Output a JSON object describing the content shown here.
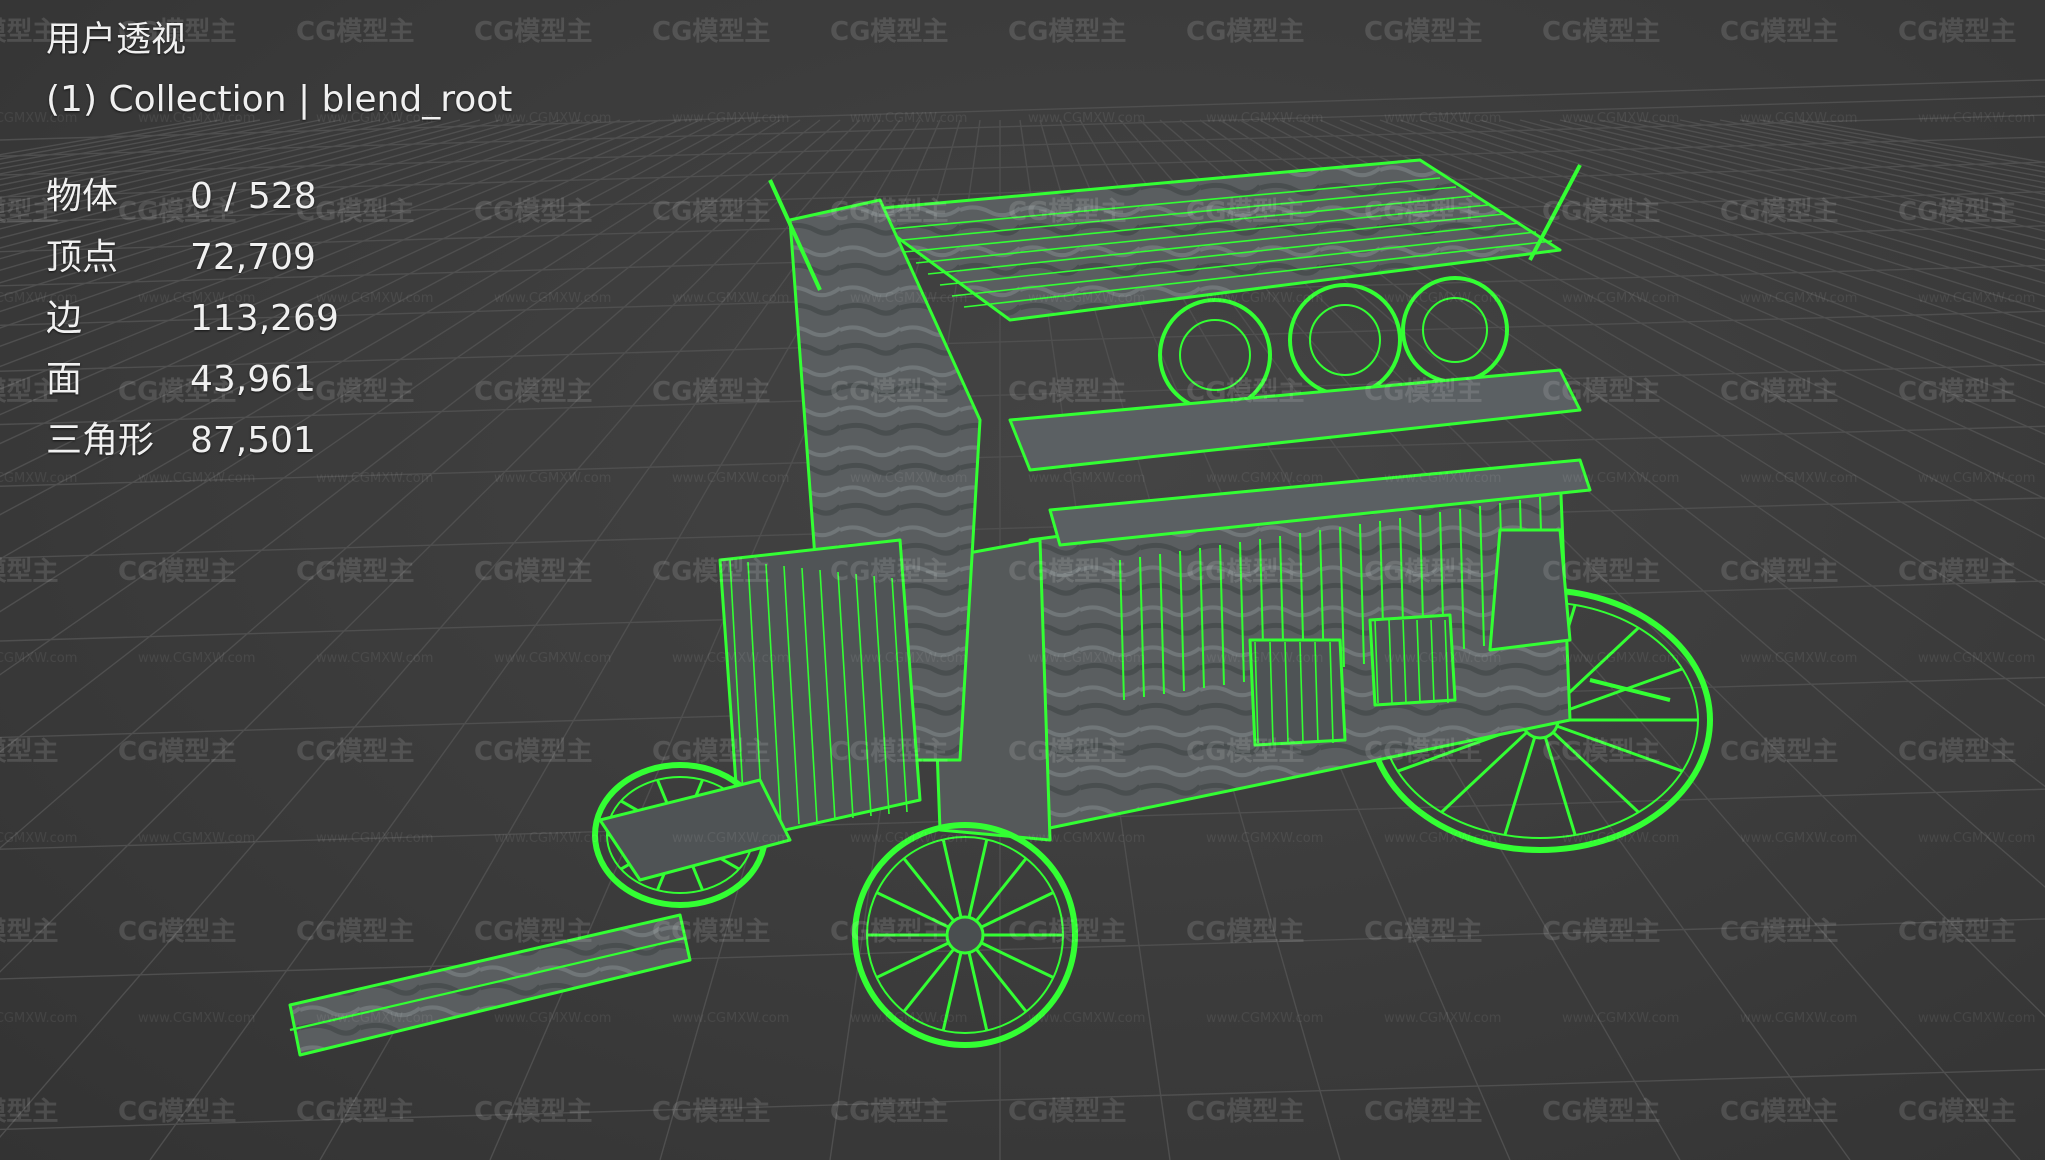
{
  "viewport": {
    "view_name": "用户透视",
    "collection_line": "(1) Collection | blend_root",
    "background_color": "#3a3a3a",
    "grid_color": "#4f4f4f",
    "wireframe_color": "#33ff33",
    "stats": [
      {
        "label": "物体",
        "value": "0 / 528"
      },
      {
        "label": "顶点",
        "value": "72,709"
      },
      {
        "label": "边",
        "value": "113,269"
      },
      {
        "label": "面",
        "value": "43,961"
      },
      {
        "label": "三角形",
        "value": "87,501"
      }
    ]
  },
  "watermark": {
    "logo_text": "CG模型主",
    "url_text": "www.CGMXW.com"
  }
}
